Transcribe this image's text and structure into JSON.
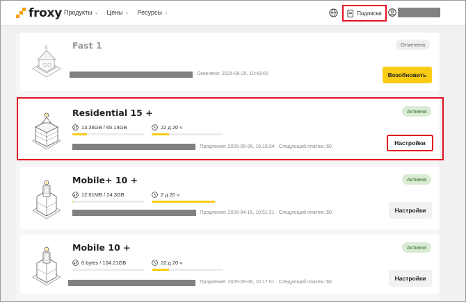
{
  "header": {
    "logo_text": "froxy",
    "nav": [
      {
        "label": "Продукты"
      },
      {
        "label": "Цены"
      },
      {
        "label": "Ресурсы"
      }
    ],
    "subscriptions_label": "Подписки",
    "icons": [
      "globe-icon",
      "document-icon",
      "user-icon"
    ]
  },
  "colors": {
    "accent": "#f8cc14",
    "brand": "#f5a300",
    "active_badge": "#d9ecd3",
    "highlight": "#e0101f"
  },
  "subscriptions": [
    {
      "title": "Fast 1",
      "status": "Отменена",
      "meta": "Окончено: 2025-08-25, 10:49:00",
      "button": "Возобновить"
    },
    {
      "title": "Residential 15 +",
      "status": "Активна",
      "traffic": "13.36GB / 65.14GB",
      "traffic_fraction": 0.2,
      "time": "22 д 20 ч",
      "time_fraction": 0.24,
      "meta": "Продление: 2026-05-06, 10:18:34",
      "next_payment": "Следующий платеж: $0",
      "button": "Настройки"
    },
    {
      "title": "Mobile+ 10 +",
      "status": "Активна",
      "traffic": "12.61MB / 24.3GB",
      "traffic_fraction": 0.01,
      "time": "2 д 20 ч",
      "time_fraction": 0.98,
      "meta": "Продление: 2026-04-16, 10:51:21",
      "next_payment": "Следующий платеж: $0",
      "button": "Настройки"
    },
    {
      "title": "Mobile 10 +",
      "status": "Активна",
      "traffic": "0 bytes / 104.21GB",
      "traffic_fraction": 0.0,
      "time": "22 д 20 ч",
      "time_fraction": 0.24,
      "meta": "Продление: 2026-05-06, 10:17:01",
      "next_payment": "Следующий платеж: $0",
      "button": "Настройки"
    }
  ]
}
